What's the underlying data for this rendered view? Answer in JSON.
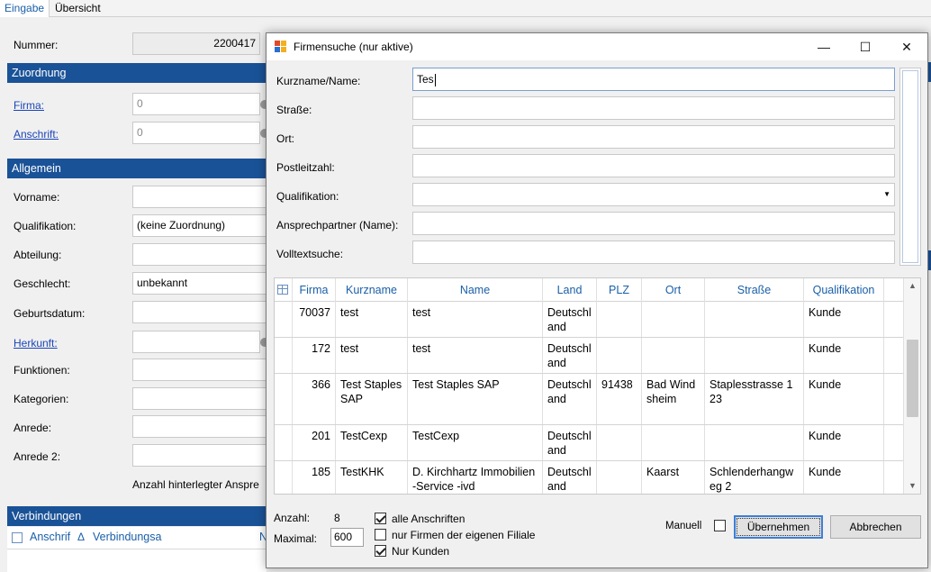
{
  "background": {
    "tabs": [
      "Eingabe",
      "Übersicht"
    ],
    "nummer_label": "Nummer:",
    "nummer_value": "2200417",
    "sections": {
      "zuordnung": "Zuordnung",
      "allgemein": "Allgemein",
      "verbindungen": "Verbindungen"
    },
    "firma_label": "Firma:",
    "firma_value": "0",
    "anschrift_label": "Anschrift:",
    "anschrift_value": "0",
    "fields": [
      {
        "label": "Vorname:",
        "value": "",
        "link": false
      },
      {
        "label": "Qualifikation:",
        "value": "(keine Zuordnung)",
        "link": false
      },
      {
        "label": "Abteilung:",
        "value": "",
        "link": false
      },
      {
        "label": "Geschlecht:",
        "value": "unbekannt",
        "link": false
      },
      {
        "label": "Geburtsdatum:",
        "value": "",
        "link": false
      },
      {
        "label": "Herkunft:",
        "value": "",
        "link": true
      },
      {
        "label": "Funktionen:",
        "value": "",
        "link": false
      },
      {
        "label": "Kategorien:",
        "value": "",
        "link": false
      },
      {
        "label": "Anrede:",
        "value": "",
        "link": false
      },
      {
        "label": "Anrede 2:",
        "value": "",
        "link": false
      }
    ],
    "anzahl_ansprech": "Anzahl hinterlegter Anspre",
    "verbindungen_cols": [
      "Anschrif",
      "Verbindungsa",
      "N"
    ],
    "sort_glyph": "Δ"
  },
  "dialog": {
    "title": "Firmensuche  (nur aktive)",
    "window_buttons": {
      "minimize": "—",
      "maximize": "☐",
      "close": "✕"
    },
    "form": {
      "kurzname_label": "Kurzname/Name:",
      "kurzname_value": "Tes",
      "strasse_label": "Straße:",
      "strasse_value": "",
      "ort_label": "Ort:",
      "ort_value": "",
      "plz_label": "Postleitzahl:",
      "plz_value": "",
      "qualifikation_label": "Qualifikation:",
      "qualifikation_value": "",
      "ansprechpartner_label": "Ansprechpartner (Name):",
      "ansprechpartner_value": "",
      "volltext_label": "Volltextsuche:",
      "volltext_value": ""
    },
    "grid": {
      "columns": [
        "Firma",
        "Kurzname",
        "Name",
        "Land",
        "PLZ",
        "Ort",
        "Straße",
        "Qualifikation"
      ],
      "rows": [
        {
          "firma": "70037",
          "kurzname": "test",
          "name": "test",
          "land": "Deutschland",
          "plz": "",
          "ort": "",
          "strasse": "",
          "qualifikation": "Kunde"
        },
        {
          "firma": "172",
          "kurzname": "test",
          "name": "test",
          "land": "Deutschland",
          "plz": "",
          "ort": "",
          "strasse": "",
          "qualifikation": "Kunde"
        },
        {
          "firma": "366",
          "kurzname": "Test Staples SAP",
          "name": "Test Staples SAP",
          "land": "Deutschland",
          "plz": "91438",
          "ort": "Bad Windsheim",
          "strasse": "Staplesstrasse 123",
          "qualifikation": "Kunde"
        },
        {
          "firma": "201",
          "kurzname": "TestCexp",
          "name": "TestCexp",
          "land": "Deutschland",
          "plz": "",
          "ort": "",
          "strasse": "",
          "qualifikation": "Kunde"
        },
        {
          "firma": "185",
          "kurzname": "TestKHK",
          "name": "D. Kirchhartz Immobilien-Service -ivd",
          "land": "Deutschland",
          "plz": "",
          "ort": "Kaarst",
          "strasse": "Schlenderhangweg 2",
          "qualifikation": "Kunde"
        }
      ]
    },
    "footer": {
      "anzahl_label": "Anzahl:",
      "anzahl_value": "8",
      "maximal_label": "Maximal:",
      "maximal_value": "600",
      "checkboxes": [
        {
          "label": "alle Anschriften",
          "checked": true
        },
        {
          "label": "nur Firmen der eigenen Filiale",
          "checked": false
        },
        {
          "label": "Nur Kunden",
          "checked": true
        }
      ],
      "manuell_label": "Manuell",
      "manuell_checked": false,
      "uebernehmen_label": "Übernehmen",
      "abbrechen_label": "Abbrechen"
    }
  },
  "colors": {
    "section_header": "#1a5297",
    "link": "#1a46b8",
    "grid_header_text": "#1a5fa8",
    "primary_border": "#3c7fd6"
  }
}
